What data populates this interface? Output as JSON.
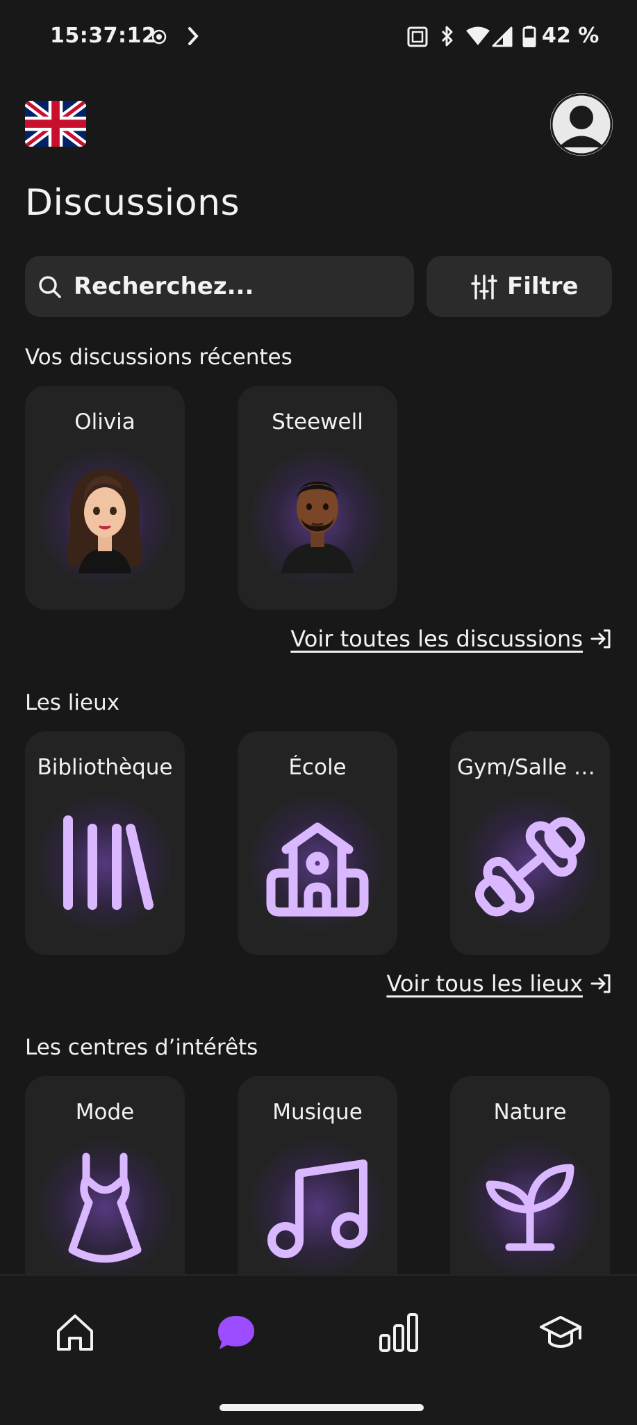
{
  "status_bar": {
    "time": "15:37:12",
    "battery": "42 %",
    "icons": [
      "record-icon",
      "chevron-right-icon",
      "nfc-icon",
      "bluetooth-icon",
      "wifi-icon",
      "signal-icon",
      "battery-icon"
    ]
  },
  "header": {
    "language_flag": "uk-flag-icon",
    "profile": "profile-avatar-icon",
    "title": "Discussions"
  },
  "search": {
    "placeholder": "Recherchez...",
    "filter_label": "Filtre"
  },
  "recent": {
    "title": "Vos discussions récentes",
    "items": [
      {
        "name": "Olivia"
      },
      {
        "name": "Steewell"
      }
    ],
    "see_all": "Voir toutes les discussions"
  },
  "places": {
    "title": "Les lieux",
    "items": [
      {
        "name": "Bibliothèque",
        "icon": "library-icon"
      },
      {
        "name": "École",
        "icon": "school-icon"
      },
      {
        "name": "Gym/Salle d...",
        "icon": "dumbbell-icon"
      }
    ],
    "see_all": "Voir tous les lieux"
  },
  "interests": {
    "title": "Les centres d’intérêts",
    "items": [
      {
        "name": "Mode",
        "icon": "dress-icon"
      },
      {
        "name": "Musique",
        "icon": "music-icon"
      },
      {
        "name": "Nature",
        "icon": "sprout-icon"
      }
    ]
  },
  "bottom_nav": {
    "items": [
      "home-icon",
      "chat-icon",
      "stats-icon",
      "learning-icon"
    ],
    "active": "chat-icon"
  },
  "colors": {
    "background": "#181818",
    "card": "#232323",
    "accent": "#9b4dff",
    "icon_lilac": "#d9b8ff"
  }
}
